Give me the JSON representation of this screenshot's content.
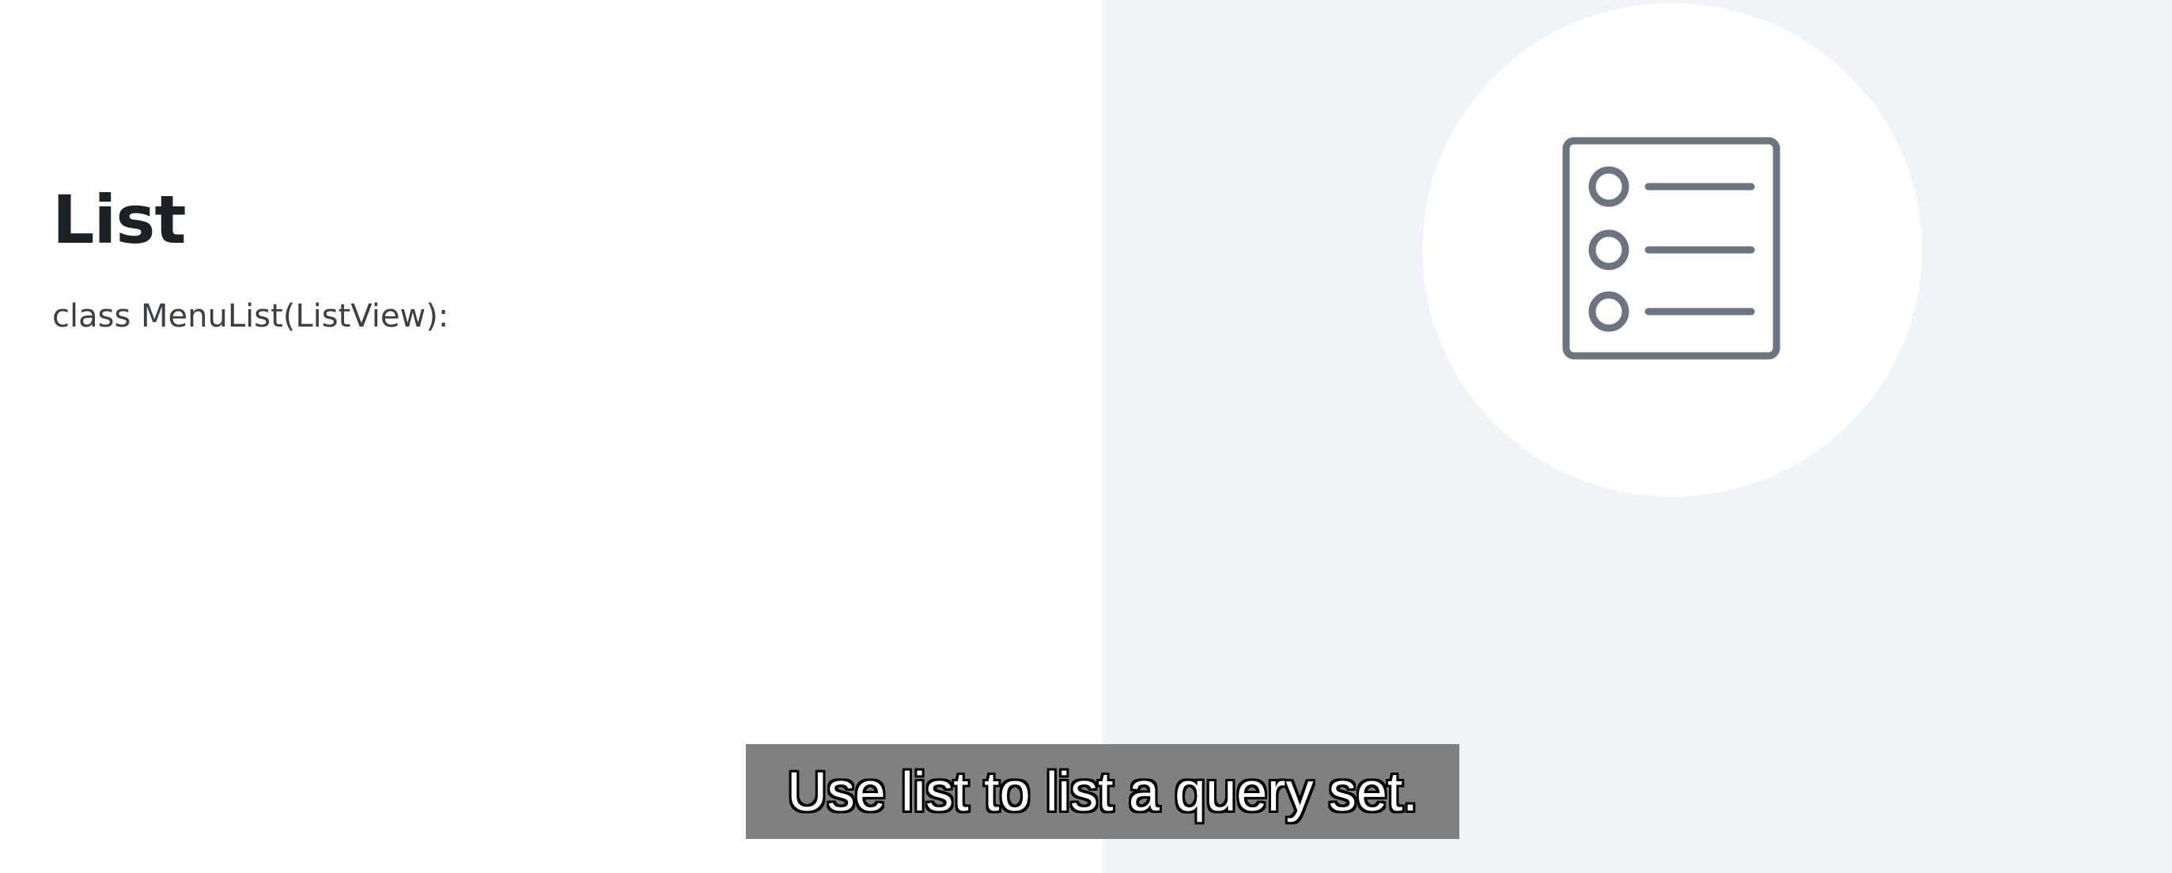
{
  "slide": {
    "title": "List",
    "code": "class MenuList(ListView):"
  },
  "illustration": {
    "icon": "list-icon",
    "icon_color": "#6b7480",
    "circle_color": "#ffffff",
    "panel_color": "#f0f3f8"
  },
  "caption": {
    "text": "Use list to list a query set."
  }
}
